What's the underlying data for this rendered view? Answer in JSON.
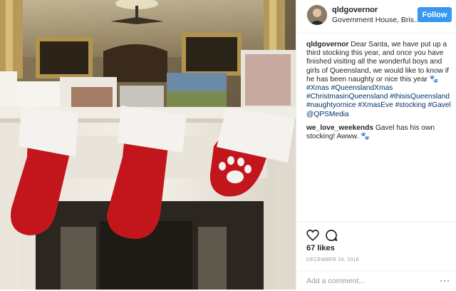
{
  "post": {
    "username": "qldgovernor",
    "location": "Government House, Bris...",
    "follow_label": "Follow"
  },
  "comments": [
    {
      "user": "qldgovernor",
      "parts": [
        {
          "t": "text",
          "v": " Dear Santa, we have put up a third stocking this year, and once you have finished visiting all the wonderful boys and girls of Queensland, we would like to know if he has been naughty or nice this year 🐾 "
        },
        {
          "t": "tag",
          "v": "#Xmas"
        },
        {
          "t": "text",
          "v": " "
        },
        {
          "t": "tag",
          "v": "#QueenslandXmas"
        },
        {
          "t": "text",
          "v": " "
        },
        {
          "t": "tag",
          "v": "#ChristmasinQueensland"
        },
        {
          "t": "text",
          "v": " "
        },
        {
          "t": "tag",
          "v": "#thisisQueensland"
        },
        {
          "t": "text",
          "v": " "
        },
        {
          "t": "tag",
          "v": "#naughtyornice"
        },
        {
          "t": "text",
          "v": " "
        },
        {
          "t": "tag",
          "v": "#XmasEve"
        },
        {
          "t": "text",
          "v": " "
        },
        {
          "t": "tag",
          "v": "#stocking"
        },
        {
          "t": "text",
          "v": " "
        },
        {
          "t": "tag",
          "v": "#Gavel"
        },
        {
          "t": "text",
          "v": " "
        },
        {
          "t": "tag",
          "v": "@QPSMedia"
        }
      ]
    },
    {
      "user": "we_love_weekends",
      "parts": [
        {
          "t": "text",
          "v": " Gavel has his own stocking! Awww. 🐾"
        }
      ]
    }
  ],
  "actions": {
    "like_icon": "heart-icon",
    "comment_icon": "comment-icon",
    "likes": "67 likes",
    "date": "DECEMBER 24, 2018",
    "comment_placeholder": "Add a comment...",
    "more_label": "···"
  },
  "colors": {
    "follow": "#3897f0",
    "hashtag": "#003569",
    "stocking_red": "#c3161c",
    "stocking_white": "#f4f2ee"
  }
}
